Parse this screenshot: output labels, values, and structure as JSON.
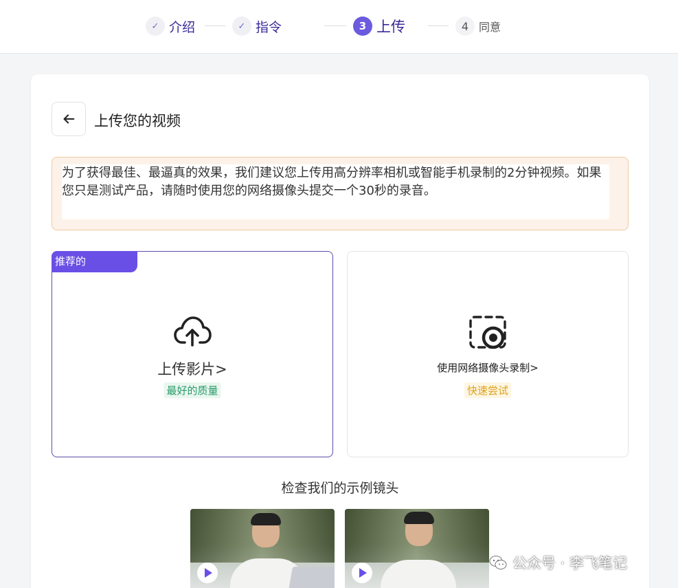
{
  "stepper": {
    "steps": [
      {
        "number": "✓",
        "label": "介绍",
        "state": "done"
      },
      {
        "number": "✓",
        "label": "指令",
        "state": "done"
      },
      {
        "number": "3",
        "label": "上传",
        "state": "active"
      },
      {
        "number": "4",
        "label": "同意",
        "state": "todo"
      }
    ]
  },
  "card": {
    "back_icon": "arrow-left-icon",
    "title": "上传您的视频",
    "notice": "为了获得最佳、最逼真的效果，我们建议您上传用高分辨率相机或智能手机录制的2分钟视频。如果您只是测试产品，请随时使用您的网络摄像头提交一个30秒的录音。"
  },
  "options": {
    "upload": {
      "badge": "推荐的",
      "icon": "cloud-upload-icon",
      "label": "上传影片>",
      "tag": "最好的质量"
    },
    "webcam": {
      "icon": "webcam-record-icon",
      "label": "使用网络摄像头录制>",
      "tag": "快速尝试"
    }
  },
  "examples": {
    "title": "检查我们的示例镜头",
    "items": [
      {
        "icon": "play-icon"
      },
      {
        "icon": "play-icon"
      }
    ]
  },
  "watermark": {
    "icon": "wechat-icon",
    "text": "公众号 · 李飞笔记"
  },
  "colors": {
    "accent": "#6a4fe6",
    "notice_bg": "#fdf2e9",
    "tag_green": "#2a9a6a",
    "tag_orange": "#e0a21b"
  }
}
